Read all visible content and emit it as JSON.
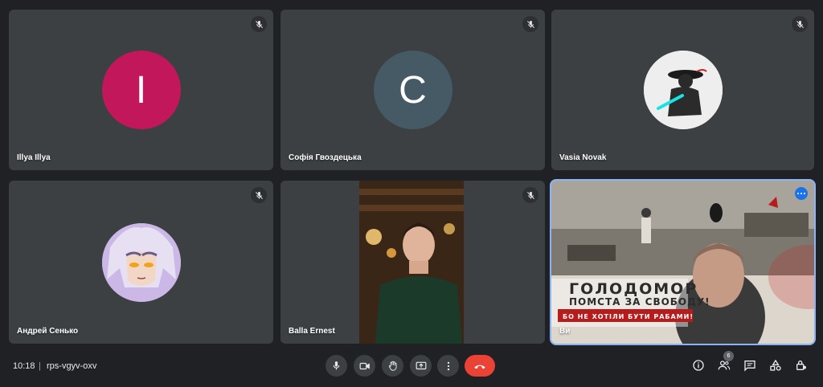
{
  "participants": [
    {
      "name": "Illya Illya",
      "initial": "I",
      "color": "#c2185b",
      "muted": true
    },
    {
      "name": "Софія Гвоздецька",
      "initial": "C",
      "color": "#455a64",
      "muted": true
    },
    {
      "name": "Vasia Novak",
      "muted": true
    },
    {
      "name": "Андрей Сенько",
      "muted": true
    },
    {
      "name": "Balla Ernest",
      "muted": true
    },
    {
      "name": "Ви",
      "muted": false
    }
  ],
  "presentation": {
    "title": "ГОЛОДОМОР",
    "subtitle": "ПОМСТА ЗА СВОБОДУ!",
    "tagline": "БО НЕ ХОТІЛИ БУТИ РАБАМИ!"
  },
  "meeting": {
    "time": "10:18",
    "separator": "|",
    "code": "rps-vgyv-oxv",
    "participant_count": "6"
  },
  "colors": {
    "background": "#202124",
    "tile": "#3c4043",
    "hangup": "#ea4335",
    "active_outline": "#8ab4f8"
  }
}
